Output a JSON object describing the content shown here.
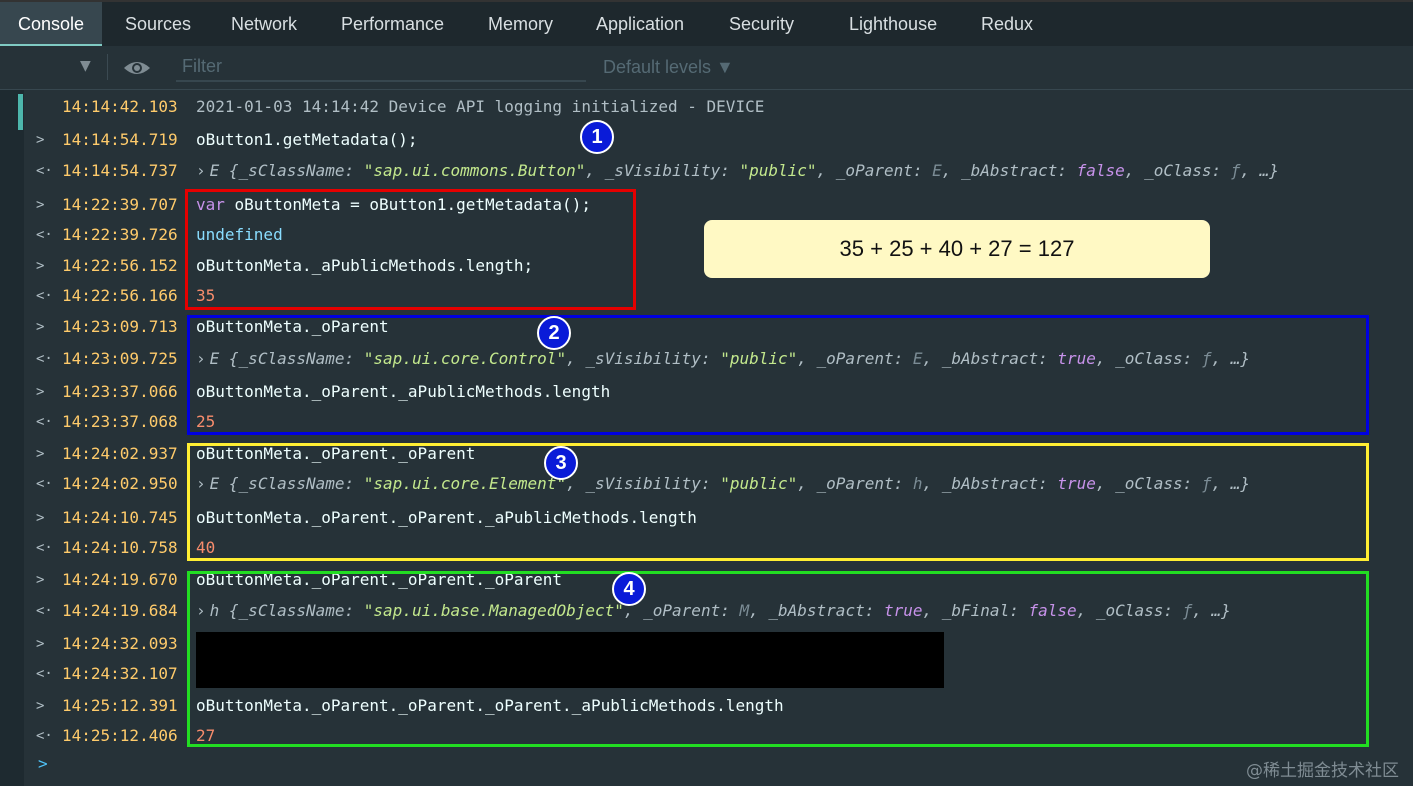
{
  "tabs": [
    "Console",
    "Sources",
    "Network",
    "Performance",
    "Memory",
    "Application",
    "Security",
    "Lighthouse",
    "Redux"
  ],
  "toolbar": {
    "filter_placeholder": "Filter",
    "levels_label": "Default levels ▼"
  },
  "lines": [
    {
      "arrow": "",
      "ts": "14:14:42.103",
      "text": "2021-01-03 14:14:42 Device API logging initialized - DEVICE"
    },
    {
      "arrow": ">",
      "ts": "14:14:54.719",
      "text": "oButton1.getMetadata();"
    },
    {
      "arrow": "<·",
      "ts": "14:14:54.737",
      "obj": {
        "prefix": "E {",
        "parts": [
          [
            "_sClassName",
            ": ",
            "\"sap.ui.commons.Button\"",
            "s"
          ],
          [
            "_sVisibility",
            ": ",
            "\"public\"",
            "s"
          ],
          [
            "_oParent",
            ": ",
            "E",
            "d"
          ],
          [
            "_bAbstract",
            ": ",
            "false",
            "b"
          ],
          [
            "_oClass",
            ": ",
            "ƒ",
            "d"
          ]
        ],
        "suffix": ", …}"
      }
    },
    {
      "arrow": ">",
      "ts": "14:22:39.707",
      "kw": "var",
      "text": " oButtonMeta = oButton1.getMetadata();"
    },
    {
      "arrow": "<·",
      "ts": "14:22:39.726",
      "text": "undefined",
      "cls": "undef"
    },
    {
      "arrow": ">",
      "ts": "14:22:56.152",
      "text": "oButtonMeta._aPublicMethods.length;"
    },
    {
      "arrow": "<·",
      "ts": "14:22:56.166",
      "text": "35",
      "cls": "num"
    },
    {
      "arrow": ">",
      "ts": "14:23:09.713",
      "text": "oButtonMeta._oParent"
    },
    {
      "arrow": "<·",
      "ts": "14:23:09.725",
      "obj": {
        "prefix": "E {",
        "parts": [
          [
            "_sClassName",
            ": ",
            "\"sap.ui.core.Control\"",
            "s"
          ],
          [
            "_sVisibility",
            ": ",
            "\"public\"",
            "s"
          ],
          [
            "_oParent",
            ": ",
            "E",
            "d"
          ],
          [
            "_bAbstract",
            ": ",
            "true",
            "b"
          ],
          [
            "_oClass",
            ": ",
            "ƒ",
            "d"
          ]
        ],
        "suffix": ", …}"
      }
    },
    {
      "arrow": ">",
      "ts": "14:23:37.066",
      "text": "oButtonMeta._oParent._aPublicMethods.length"
    },
    {
      "arrow": "<·",
      "ts": "14:23:37.068",
      "text": "25",
      "cls": "num"
    },
    {
      "arrow": ">",
      "ts": "14:24:02.937",
      "text": "oButtonMeta._oParent._oParent"
    },
    {
      "arrow": "<·",
      "ts": "14:24:02.950",
      "obj": {
        "prefix": "E {",
        "parts": [
          [
            "_sClassName",
            ": ",
            "\"sap.ui.core.Element\"",
            "s"
          ],
          [
            "_sVisibility",
            ": ",
            "\"public\"",
            "s"
          ],
          [
            "_oParent",
            ": ",
            "h",
            "d"
          ],
          [
            "_bAbstract",
            ": ",
            "true",
            "b"
          ],
          [
            "_oClass",
            ": ",
            "ƒ",
            "d"
          ]
        ],
        "suffix": ", …}"
      }
    },
    {
      "arrow": ">",
      "ts": "14:24:10.745",
      "text": "oButtonMeta._oParent._oParent._aPublicMethods.length"
    },
    {
      "arrow": "<·",
      "ts": "14:24:10.758",
      "text": "40",
      "cls": "num"
    },
    {
      "arrow": ">",
      "ts": "14:24:19.670",
      "text": "oButtonMeta._oParent._oParent._oParent"
    },
    {
      "arrow": "<·",
      "ts": "14:24:19.684",
      "obj": {
        "prefix": "h {",
        "parts": [
          [
            "_sClassName",
            ": ",
            "\"sap.ui.base.ManagedObject\"",
            "s"
          ],
          [
            "_oParent",
            ": ",
            "M",
            "d"
          ],
          [
            "_bAbstract",
            ": ",
            "true",
            "b"
          ],
          [
            "_bFinal",
            ": ",
            "false",
            "b"
          ],
          [
            "_oClass",
            ": ",
            "ƒ",
            "d"
          ]
        ],
        "suffix": ", …}"
      }
    },
    {
      "arrow": ">",
      "ts": "14:24:32.093",
      "text": ""
    },
    {
      "arrow": "<·",
      "ts": "14:24:32.107",
      "text": ""
    },
    {
      "arrow": ">",
      "ts": "14:25:12.391",
      "text": "oButtonMeta._oParent._oParent._oParent._aPublicMethods.length"
    },
    {
      "arrow": "<·",
      "ts": "14:25:12.406",
      "text": "27",
      "cls": "num"
    }
  ],
  "badges": [
    "1",
    "2",
    "3",
    "4"
  ],
  "annotation_colors": {
    "red": "#e50000",
    "blue": "#0000e0",
    "yellow": "#ffee33",
    "green": "#22dd22"
  },
  "callout": "35 + 25 + 40 + 27 = 127",
  "prompt_symbol": ">",
  "watermark": "@稀土掘金技术社区"
}
